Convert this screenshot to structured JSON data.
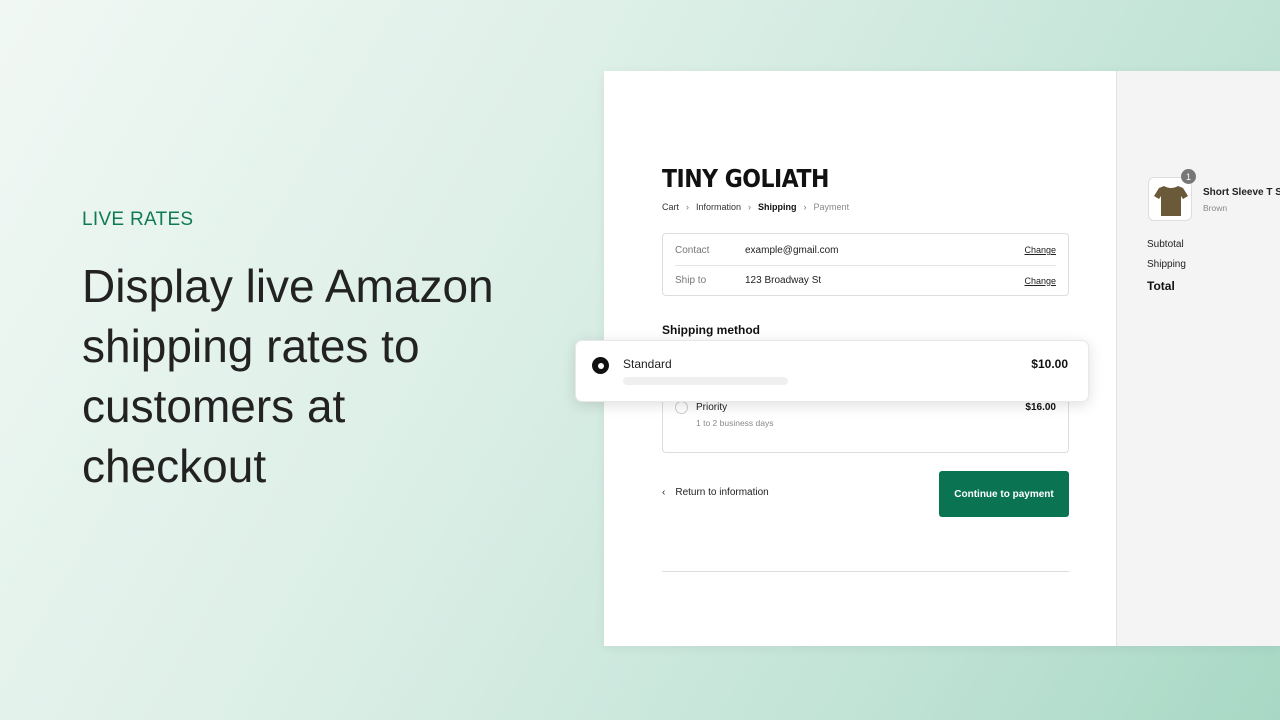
{
  "hero": {
    "eyebrow": "LIVE RATES",
    "headline": "Display live Amazon shipping rates to customers at checkout",
    "accent": "#0f7a55"
  },
  "checkout": {
    "logo": "TINY GOLIATH",
    "breadcrumb": [
      "Cart",
      "Information",
      "Shipping",
      "Payment"
    ],
    "contact": {
      "label": "Contact",
      "value": "example@gmail.com",
      "change": "Change"
    },
    "ship_to": {
      "label": "Ship to",
      "value": "123 Broadway St",
      "change": "Change"
    },
    "shipping_method_title": "Shipping method",
    "options": [
      {
        "name": "Standard",
        "price": "$10.00",
        "selected": true
      },
      {
        "name": "Priority",
        "detail": "1 to 2 business days",
        "price": "$16.00",
        "selected": false
      }
    ],
    "back_link": "Return to information",
    "continue_button": "Continue to payment",
    "button_color": "#0a7352"
  },
  "summary": {
    "product": {
      "name": "Short Sleeve T S",
      "variant": "Brown",
      "quantity": "1"
    },
    "subtotal": "Subtotal",
    "shipping": "Shipping",
    "total": "Total"
  }
}
